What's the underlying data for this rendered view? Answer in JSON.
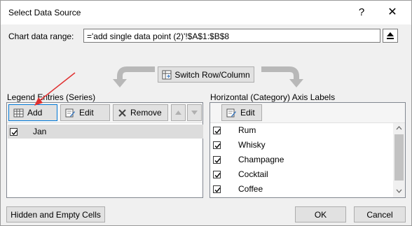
{
  "window": {
    "title": "Select Data Source",
    "help_glyph": "?",
    "close_glyph": "✕"
  },
  "range": {
    "label": "Chart data range:",
    "value": "='add single data point (2)'!$A$1:$B$8"
  },
  "switch_label": "Switch Row/Column",
  "legend": {
    "label": "Legend Entries (Series)",
    "add_label": "Add",
    "edit_label": "Edit",
    "remove_label": "Remove",
    "items": [
      {
        "label": "Jan",
        "checked": true
      }
    ]
  },
  "axis": {
    "label": "Horizontal (Category) Axis Labels",
    "edit_label": "Edit",
    "items": [
      {
        "label": "Rum",
        "checked": true
      },
      {
        "label": "Whisky",
        "checked": true
      },
      {
        "label": "Champagne",
        "checked": true
      },
      {
        "label": "Cocktail",
        "checked": true
      },
      {
        "label": "Coffee",
        "checked": true
      }
    ]
  },
  "footer": {
    "hidden_cells_label": "Hidden and Empty Cells",
    "ok_label": "OK",
    "cancel_label": "Cancel"
  },
  "colors": {
    "selection": "#dcdcdc",
    "arrow": "#e03030",
    "default_border": "#0078d7"
  }
}
